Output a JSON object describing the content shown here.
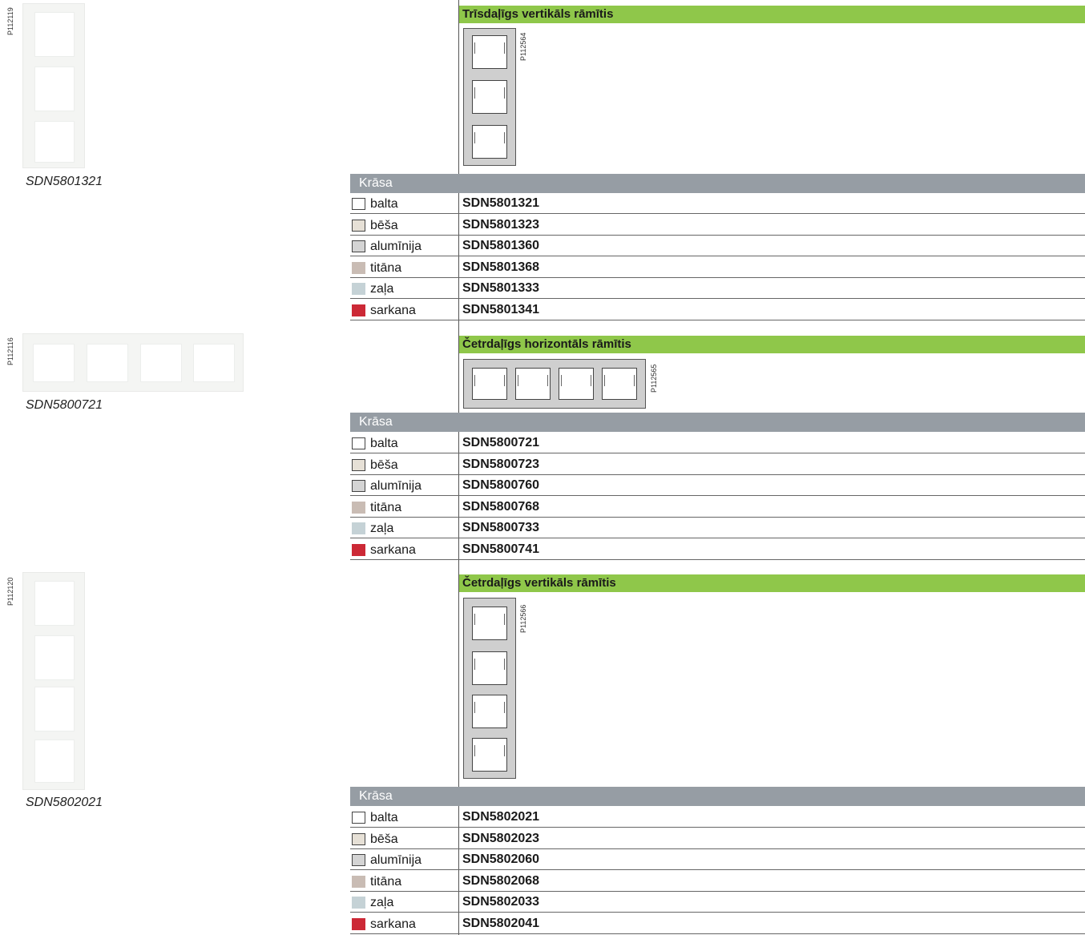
{
  "sections": [
    {
      "title": "Trīsdaļīgs vertikāls rāmītis",
      "photo_code": "P112119",
      "caption": "SDN5801321",
      "drawing_code": "P112564",
      "header": "Krāsa",
      "rows": [
        {
          "color": "balta",
          "ref": "SDN5801321"
        },
        {
          "color": "bēša",
          "ref": "SDN5801323"
        },
        {
          "color": "alumīnija",
          "ref": "SDN5801360"
        },
        {
          "color": "titāna",
          "ref": "SDN5801368"
        },
        {
          "color": "zaļa",
          "ref": "SDN5801333"
        },
        {
          "color": "sarkana",
          "ref": "SDN5801341"
        }
      ]
    },
    {
      "title": "Četrdaļīgs horizontāls rāmītis",
      "photo_code": "P112116",
      "caption": "SDN5800721",
      "drawing_code": "P112565",
      "header": "Krāsa",
      "rows": [
        {
          "color": "balta",
          "ref": "SDN5800721"
        },
        {
          "color": "bēša",
          "ref": "SDN5800723"
        },
        {
          "color": "alumīnija",
          "ref": "SDN5800760"
        },
        {
          "color": "titāna",
          "ref": "SDN5800768"
        },
        {
          "color": "zaļa",
          "ref": "SDN5800733"
        },
        {
          "color": "sarkana",
          "ref": "SDN5800741"
        }
      ]
    },
    {
      "title": "Četrdaļīgs vertikāls rāmītis",
      "photo_code": "P112120",
      "caption": "SDN5802021",
      "drawing_code": "P112566",
      "header": "Krāsa",
      "rows": [
        {
          "color": "balta",
          "ref": "SDN5802021"
        },
        {
          "color": "bēša",
          "ref": "SDN5802023"
        },
        {
          "color": "alumīnija",
          "ref": "SDN5802060"
        },
        {
          "color": "titāna",
          "ref": "SDN5802068"
        },
        {
          "color": "zaļa",
          "ref": "SDN5802033"
        },
        {
          "color": "sarkana",
          "ref": "SDN5802041"
        }
      ]
    }
  ],
  "swatch_colors": {
    "balta": "#ffffff",
    "bēša": "#e6e0d6",
    "alumīnija": "#d4d4d4",
    "titāna": "#c9bcb4",
    "zaļa": "#c5d2d6",
    "sarkana": "#cc2936"
  },
  "accent_colors": {
    "title_bar": "#8fc74a",
    "header_bar": "#969da4"
  }
}
